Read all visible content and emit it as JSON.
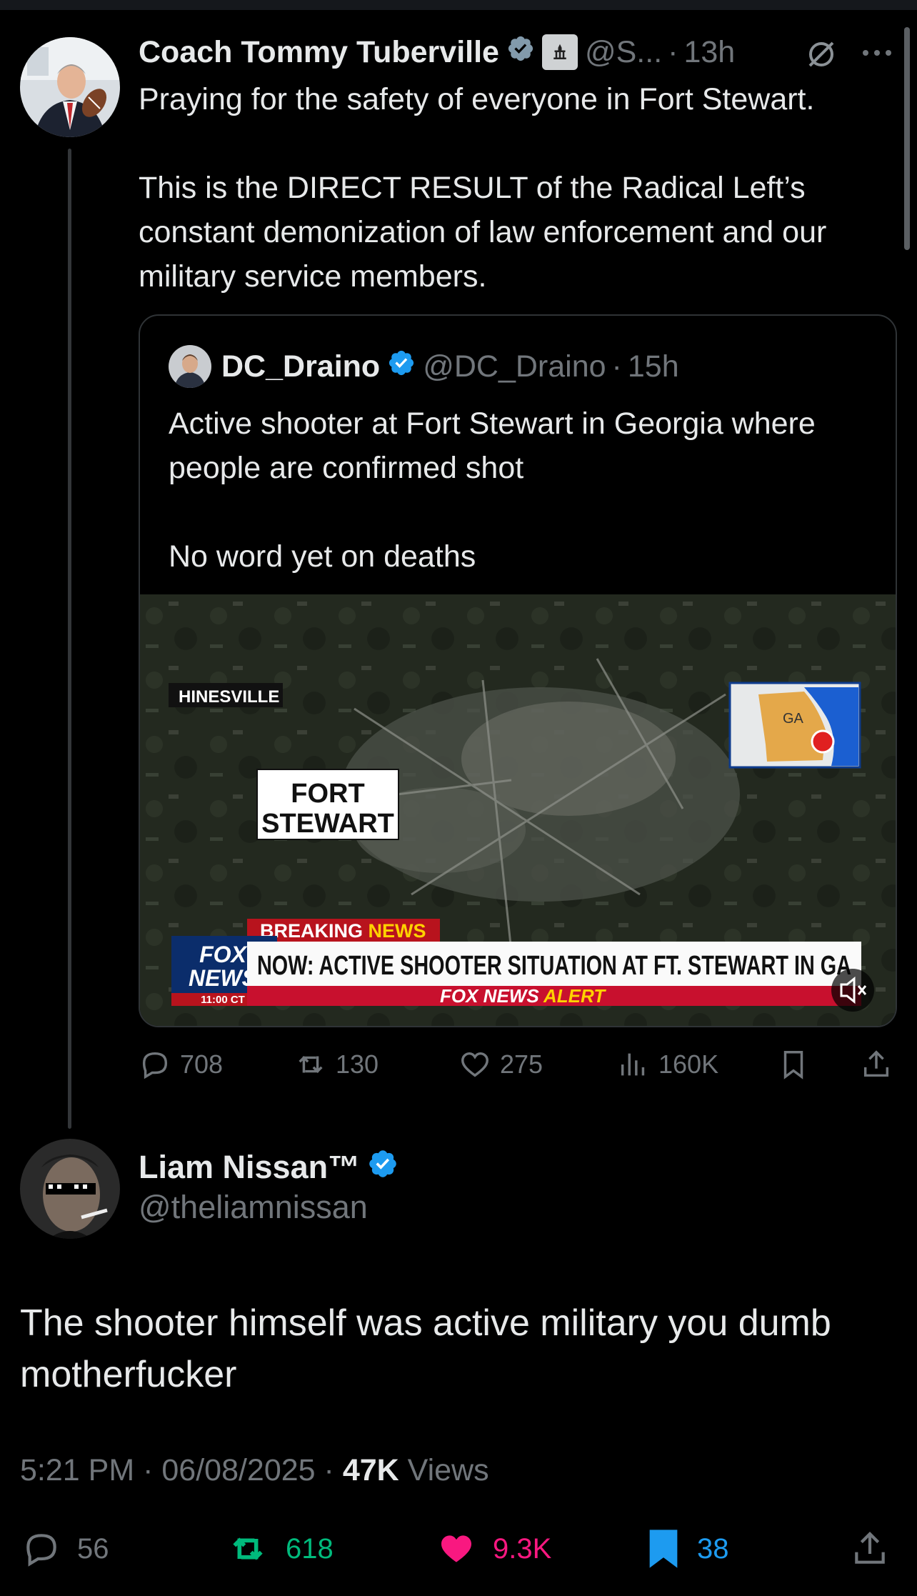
{
  "parent_tweet": {
    "author_name": "Coach Tommy Tuberville",
    "handle": "@S...",
    "time": "13h",
    "separator": "·",
    "text": "Praying for the safety of everyone in Fort Stewart.\n\nThis is the DIRECT RESULT of the Radical Left’s constant demonization of law enforcement and our military service members.",
    "quote": {
      "author_name": "DC_Draino",
      "handle": "@DC_Draino",
      "time": "15h",
      "text": "Active shooter at Fort Stewart in Georgia where people are confirmed shot\n\nNo word yet on deaths",
      "media": {
        "place_label": "HINESVILLE",
        "location_line1": "FORT",
        "location_line2": "STEWART",
        "state_label": "GA",
        "breaking_word1": "BREAKING ",
        "breaking_word2": "NEWS",
        "headline": "NOW: ACTIVE SHOOTER SITUATION AT FT. STEWART IN GA",
        "network_line1": "FOX",
        "network_line2": "NEWS",
        "clock": "11:00 CT",
        "alert_word1": "FOX NEWS ",
        "alert_word2": "ALERT"
      }
    },
    "stats": {
      "replies": "708",
      "reposts": "130",
      "likes": "275",
      "views": "160K"
    }
  },
  "reply_tweet": {
    "author_name": "Liam Nissan™",
    "handle": "@theliamnissan",
    "text": "The shooter himself was active military you dumb motherfucker",
    "time": "5:21 PM",
    "date": "06/08/2025",
    "views_count": "47K",
    "views_label": "Views",
    "separator": "·",
    "stats": {
      "replies": "56",
      "reposts": "618",
      "likes": "9.3K",
      "bookmarks": "38"
    }
  },
  "colors": {
    "background": "#000000",
    "text": "#e7e9ea",
    "muted": "#71767b",
    "verified_blue": "#1d9bf0",
    "repost_green": "#00ba7c",
    "like_pink": "#f91880"
  }
}
